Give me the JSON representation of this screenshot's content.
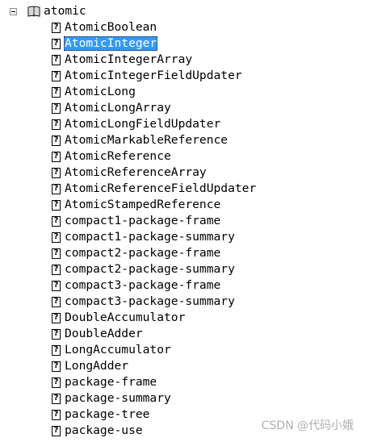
{
  "tree": {
    "root": {
      "label": "atomic",
      "toggle_symbol": "minus",
      "icon": "book-icon"
    },
    "children": [
      {
        "label": "AtomicBoolean",
        "icon": "help-page-icon",
        "selected": false
      },
      {
        "label": "AtomicInteger",
        "icon": "help-page-icon",
        "selected": true
      },
      {
        "label": "AtomicIntegerArray",
        "icon": "help-page-icon",
        "selected": false
      },
      {
        "label": "AtomicIntegerFieldUpdater",
        "icon": "help-page-icon",
        "selected": false
      },
      {
        "label": "AtomicLong",
        "icon": "help-page-icon",
        "selected": false
      },
      {
        "label": "AtomicLongArray",
        "icon": "help-page-icon",
        "selected": false
      },
      {
        "label": "AtomicLongFieldUpdater",
        "icon": "help-page-icon",
        "selected": false
      },
      {
        "label": "AtomicMarkableReference",
        "icon": "help-page-icon",
        "selected": false
      },
      {
        "label": "AtomicReference",
        "icon": "help-page-icon",
        "selected": false
      },
      {
        "label": "AtomicReferenceArray",
        "icon": "help-page-icon",
        "selected": false
      },
      {
        "label": "AtomicReferenceFieldUpdater",
        "icon": "help-page-icon",
        "selected": false
      },
      {
        "label": "AtomicStampedReference",
        "icon": "help-page-icon",
        "selected": false
      },
      {
        "label": "compact1-package-frame",
        "icon": "help-page-icon",
        "selected": false
      },
      {
        "label": "compact1-package-summary",
        "icon": "help-page-icon",
        "selected": false
      },
      {
        "label": "compact2-package-frame",
        "icon": "help-page-icon",
        "selected": false
      },
      {
        "label": "compact2-package-summary",
        "icon": "help-page-icon",
        "selected": false
      },
      {
        "label": "compact3-package-frame",
        "icon": "help-page-icon",
        "selected": false
      },
      {
        "label": "compact3-package-summary",
        "icon": "help-page-icon",
        "selected": false
      },
      {
        "label": "DoubleAccumulator",
        "icon": "help-page-icon",
        "selected": false
      },
      {
        "label": "DoubleAdder",
        "icon": "help-page-icon",
        "selected": false
      },
      {
        "label": "LongAccumulator",
        "icon": "help-page-icon",
        "selected": false
      },
      {
        "label": "LongAdder",
        "icon": "help-page-icon",
        "selected": false
      },
      {
        "label": "package-frame",
        "icon": "help-page-icon",
        "selected": false
      },
      {
        "label": "package-summary",
        "icon": "help-page-icon",
        "selected": false
      },
      {
        "label": "package-tree",
        "icon": "help-page-icon",
        "selected": false
      },
      {
        "label": "package-use",
        "icon": "help-page-icon",
        "selected": false
      }
    ],
    "help_icon_glyph": "?"
  },
  "watermark": "CSDN @代码小娥",
  "colors": {
    "selection_background": "#3399ff",
    "selection_text": "#ffffff",
    "text": "#000000",
    "watermark": "#b0b0b0"
  }
}
